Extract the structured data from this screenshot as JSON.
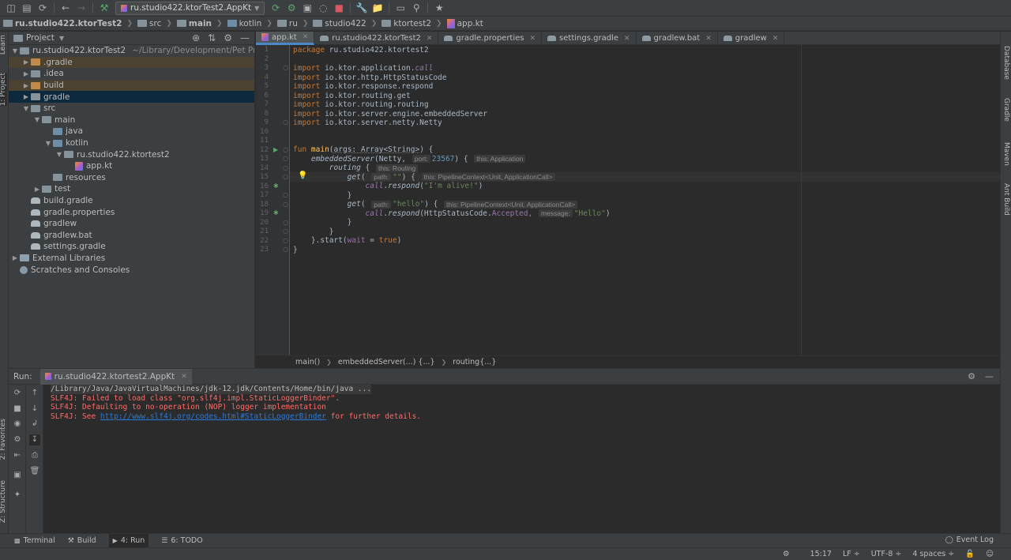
{
  "toolbar": {
    "run_config": "ru.studio422.ktorTest2.AppKt",
    "icons": [
      "save-icon",
      "sync-icon",
      "back-icon",
      "forward-icon",
      "build-hammer-icon",
      "run-icon",
      "debug-icon",
      "coverage-icon",
      "profile-icon",
      "stop-icon",
      "settings-icon",
      "project-structure-icon",
      "layout-icon",
      "vcs-icon"
    ]
  },
  "breadcrumbs": [
    "ru.studio422.ktorTest2",
    "src",
    "main",
    "kotlin",
    "ru",
    "studio422",
    "ktortest2",
    "app.kt"
  ],
  "left_stripe": {
    "tab_learn": "Learn",
    "tab_project": "1: Project",
    "tab_favorites": "2: Favorites",
    "tab_structure": "Z: Structure"
  },
  "right_stripe": {
    "tab_database": "Database",
    "tab_gradle": "Gradle",
    "tab_maven": "Maven",
    "tab_ant": "Ant Build"
  },
  "project": {
    "header": "Project",
    "root_name": "ru.studio422.ktorTest2",
    "root_path": "~/Library/Development/Pet Projects",
    "items": [
      {
        "label": ".gradle",
        "depth": 1,
        "icon": "orange",
        "arrow": "right",
        "sel": "brown"
      },
      {
        "label": ".idea",
        "depth": 1,
        "icon": "folder",
        "arrow": "right"
      },
      {
        "label": "build",
        "depth": 1,
        "icon": "orange",
        "arrow": "right",
        "sel": "brown"
      },
      {
        "label": "gradle",
        "depth": 1,
        "icon": "folder",
        "arrow": "right",
        "sel": "dark"
      },
      {
        "label": "src",
        "depth": 1,
        "icon": "folder",
        "arrow": "down"
      },
      {
        "label": "main",
        "depth": 2,
        "icon": "folder",
        "arrow": "down"
      },
      {
        "label": "java",
        "depth": 3,
        "icon": "blue",
        "arrow": ""
      },
      {
        "label": "kotlin",
        "depth": 3,
        "icon": "blue",
        "arrow": "down"
      },
      {
        "label": "ru.studio422.ktortest2",
        "depth": 4,
        "icon": "folder",
        "arrow": "down"
      },
      {
        "label": "app.kt",
        "depth": 5,
        "icon": "kt",
        "arrow": ""
      },
      {
        "label": "resources",
        "depth": 3,
        "icon": "folder",
        "arrow": ""
      },
      {
        "label": "test",
        "depth": 2,
        "icon": "folder",
        "arrow": "right"
      },
      {
        "label": "build.gradle",
        "depth": 1,
        "icon": "gradle",
        "arrow": ""
      },
      {
        "label": "gradle.properties",
        "depth": 1,
        "icon": "gradle",
        "arrow": ""
      },
      {
        "label": "gradlew",
        "depth": 1,
        "icon": "gradle",
        "arrow": ""
      },
      {
        "label": "gradlew.bat",
        "depth": 1,
        "icon": "gradle",
        "arrow": ""
      },
      {
        "label": "settings.gradle",
        "depth": 1,
        "icon": "gradle",
        "arrow": ""
      },
      {
        "label": "External Libraries",
        "depth": 0,
        "icon": "lib",
        "arrow": "right"
      },
      {
        "label": "Scratches and Consoles",
        "depth": 0,
        "icon": "scratch",
        "arrow": ""
      }
    ]
  },
  "editor_tabs": [
    {
      "label": "app.kt",
      "icon": "kt",
      "active": true
    },
    {
      "label": "ru.studio422.ktorTest2",
      "icon": "gray",
      "active": false
    },
    {
      "label": "gradle.properties",
      "icon": "gray",
      "active": false
    },
    {
      "label": "settings.gradle",
      "icon": "gray",
      "active": false
    },
    {
      "label": "gradlew.bat",
      "icon": "gray",
      "active": false
    },
    {
      "label": "gradlew",
      "icon": "gray",
      "active": false
    }
  ],
  "editor": {
    "line_numbers": [
      "1",
      "2",
      "3",
      "4",
      "5",
      "6",
      "7",
      "8",
      "9",
      "10",
      "11",
      "12",
      "13",
      "14",
      "15",
      "16",
      "17",
      "18",
      "19",
      "20",
      "21",
      "22",
      "23"
    ],
    "package_kw": "package",
    "package_name": "ru.studio422.ktortest2",
    "import_kw": "import",
    "imports": [
      {
        "pkg": "io.ktor.application.",
        "name": "call"
      },
      {
        "pkg": "io.ktor.http.HttpStatusCode",
        "name": ""
      },
      {
        "pkg": "io.ktor.response.respond",
        "name": ""
      },
      {
        "pkg": "io.ktor.routing.get",
        "name": ""
      },
      {
        "pkg": "io.ktor.routing.routing",
        "name": ""
      },
      {
        "pkg": "io.ktor.server.engine.embeddedServer",
        "name": ""
      },
      {
        "pkg": "io.ktor.server.netty.Netty",
        "name": ""
      }
    ],
    "fun_kw": "fun",
    "fun_name": "main",
    "fun_params": "args: Array<String>",
    "embedded_server": "embeddedServer",
    "netty": "Netty,",
    "port_hint": "port:",
    "port_value": "23567",
    "this_application": "this: Application",
    "routing": "routing",
    "this_routing": "this: Routing",
    "get": "get",
    "path_hint": "path:",
    "empty_path": "\"\"",
    "this_pipeline": "this: PipelineContext<Unit, ApplicationCall>",
    "call": "call",
    "respond": "respond",
    "alive_str": "\"I'm alive!\"",
    "hello_path": "\"hello\"",
    "accepted": "HttpStatusCode.",
    "accepted_name": "Accepted,",
    "message_hint": "message:",
    "hello_msg": "\"Hello\"",
    "start_prefix": "}.start(",
    "wait_param": "wait",
    "true_kw": "true"
  },
  "editor_crumbs": [
    "main()",
    "embeddedServer(...) {...}",
    "routing{...}"
  ],
  "run": {
    "label": "Run:",
    "tab": "ru.studio422.ktortest2.AppKt",
    "console": {
      "cmd": "/Library/Java/JavaVirtualMachines/jdk-12.jdk/Contents/Home/bin/java ...",
      "err1": "SLF4J: Failed to load class \"org.slf4j.impl.StaticLoggerBinder\".",
      "err2": "SLF4J: Defaulting to no-operation (NOP) logger implementation",
      "err3_prefix": "SLF4J: See ",
      "err3_link": "http://www.slf4j.org/codes.html#StaticLoggerBinder",
      "err3_suffix": " for further details."
    }
  },
  "tool_windows": {
    "terminal": "Terminal",
    "build": "Build",
    "run": "4: Run",
    "todo": "6: TODO",
    "event_log": "Event Log"
  },
  "status": {
    "time": "15:17",
    "line_sep": "LF ÷",
    "encoding": "UTF-8 ÷",
    "indent": "4 spaces ÷"
  }
}
